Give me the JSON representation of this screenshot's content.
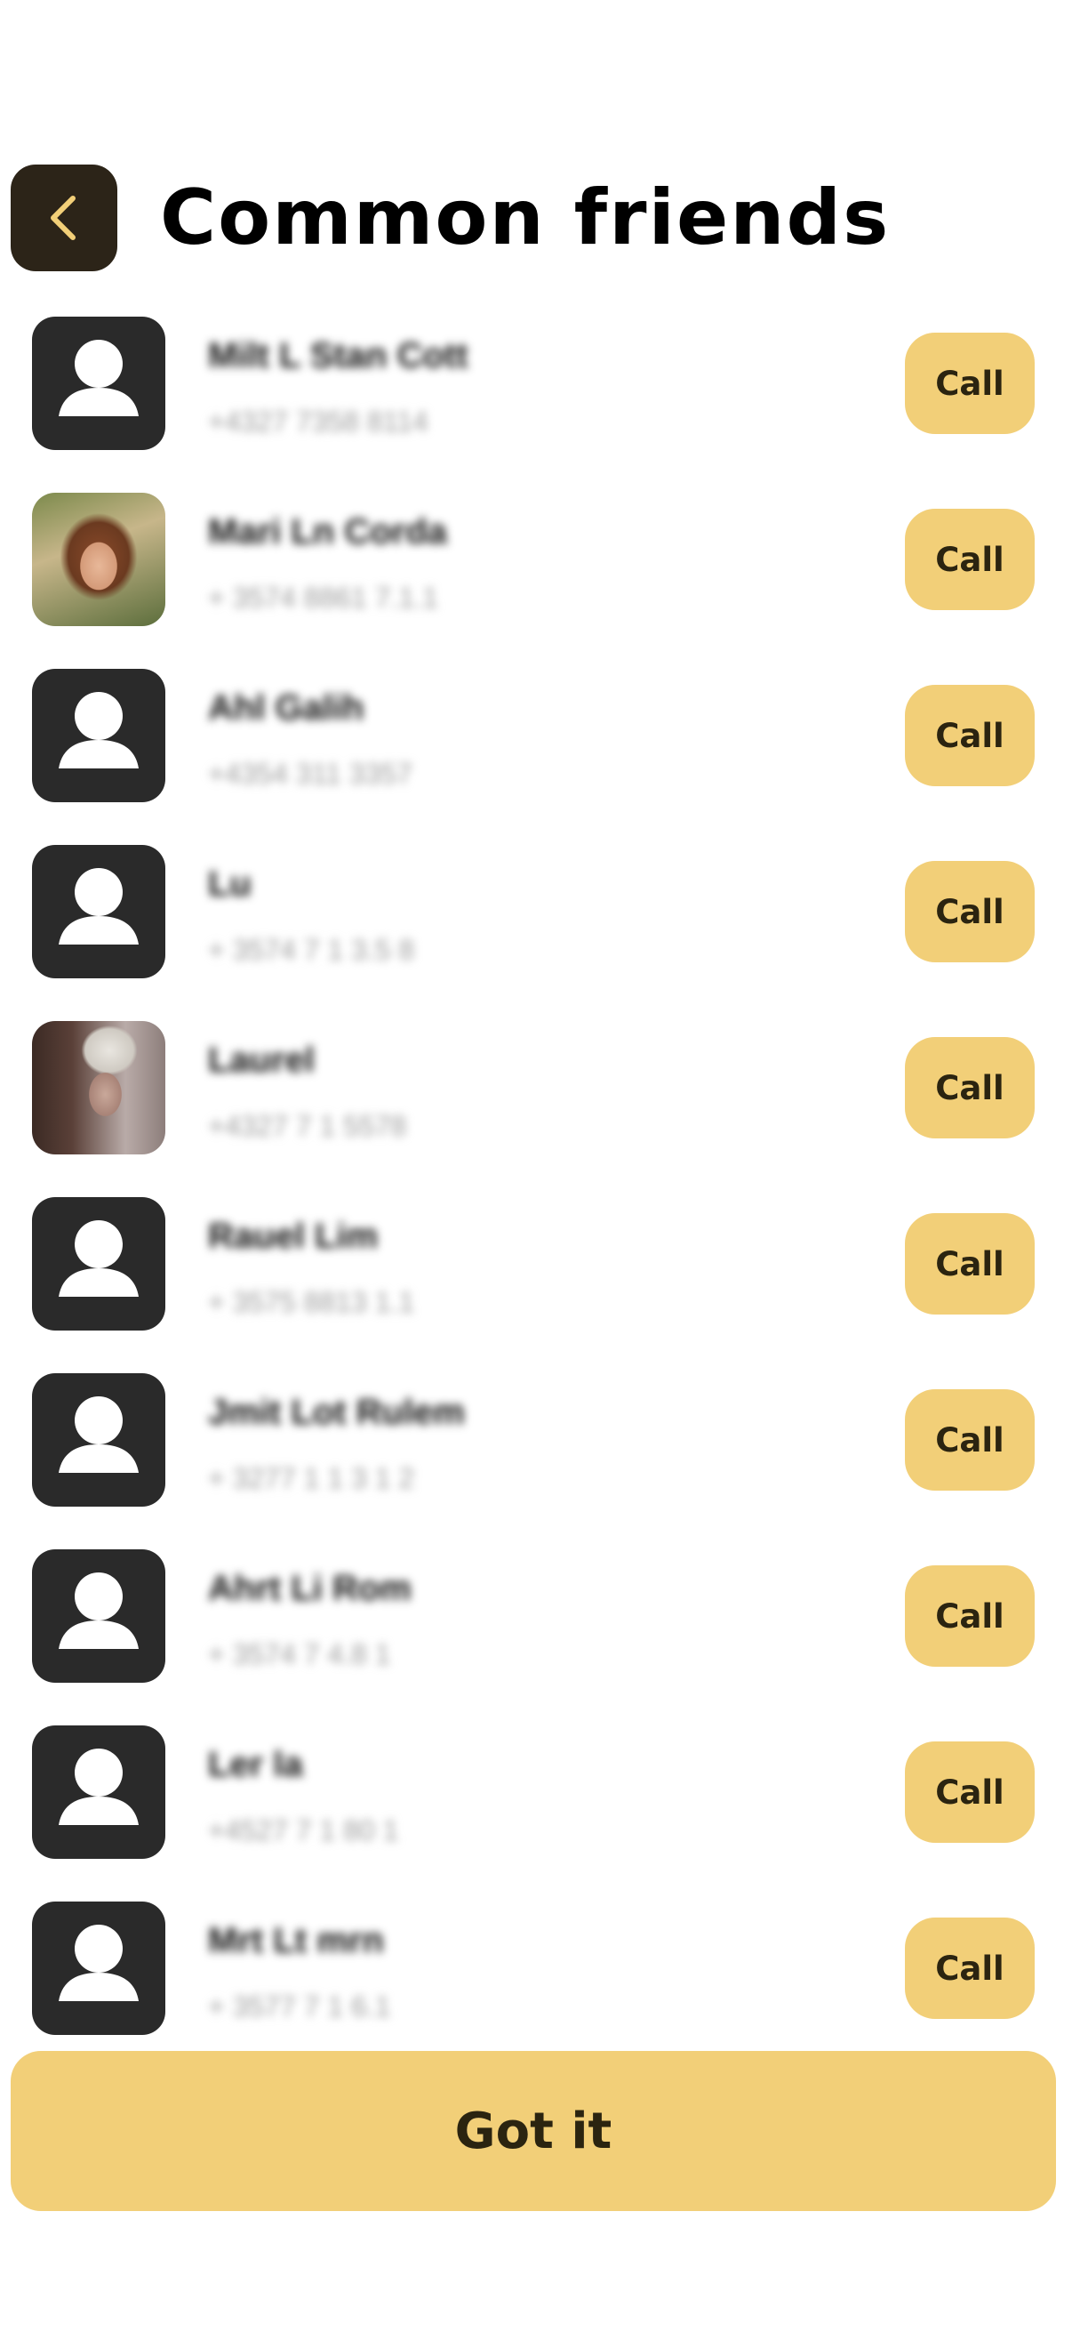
{
  "header": {
    "back_icon": "chevron-left-icon",
    "title": "Common friends"
  },
  "contacts": [
    {
      "name": "Milt L Stan Cott",
      "phone": "+4327 7358 8114",
      "avatar": "person-placeholder-icon",
      "call_label": "Call"
    },
    {
      "name": "Mari Ln Corda",
      "phone": "+ 3574 8861 7.1.1",
      "avatar": "profile-photo",
      "call_label": "Call"
    },
    {
      "name": "Ahl Galih",
      "phone": "+4354 311 3357",
      "avatar": "person-placeholder-icon",
      "call_label": "Call"
    },
    {
      "name": "Lu",
      "phone": "+ 3574 7 1 3.5 8",
      "avatar": "person-placeholder-icon",
      "call_label": "Call"
    },
    {
      "name": "Laurel",
      "phone": "+4327 7 1 5578",
      "avatar": "profile-photo",
      "call_label": "Call"
    },
    {
      "name": "Rauel Lim",
      "phone": "+ 3575 8813 1.1",
      "avatar": "person-placeholder-icon",
      "call_label": "Call"
    },
    {
      "name": "Jmit Lot Rulem",
      "phone": "+ 3277 1 1 3 1 2",
      "avatar": "person-placeholder-icon",
      "call_label": "Call"
    },
    {
      "name": "Ahrt Li Rom",
      "phone": "+ 3574 7 4.8 1",
      "avatar": "person-placeholder-icon",
      "call_label": "Call"
    },
    {
      "name": "Ler la",
      "phone": "+4527 7 1 80 1",
      "avatar": "person-placeholder-icon",
      "call_label": "Call"
    },
    {
      "name": "Mrt Lt mrn",
      "phone": "+ 3577 7 1 6.1",
      "avatar": "person-placeholder-icon",
      "call_label": "Call"
    }
  ],
  "footer": {
    "confirm_label": "Got it"
  },
  "colors": {
    "accent": "#f2cf78",
    "back_button_bg": "#2c2418",
    "back_chevron": "#f2cf78",
    "avatar_bg": "#2a2a2a"
  }
}
